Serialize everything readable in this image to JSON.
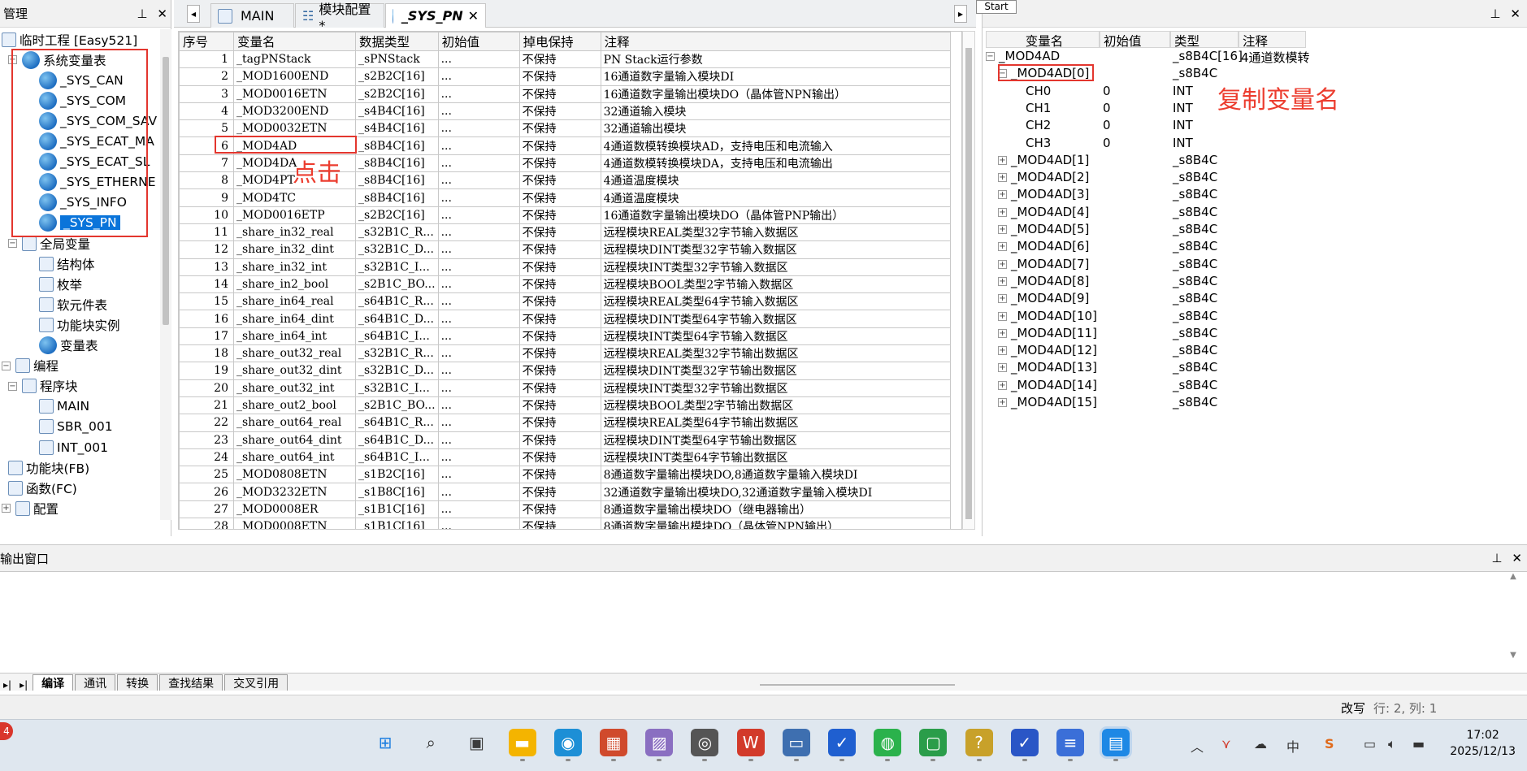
{
  "left_panel": {
    "title": "管理",
    "tree": [
      {
        "label": "临时工程 [Easy521]",
        "icon": "computer-icon",
        "expander": "",
        "name": "tree-project"
      },
      {
        "label": "系统变量表",
        "icon": "globe-icon",
        "expander": "−",
        "name": "tree-system-vars"
      },
      {
        "label": "_SYS_CAN",
        "icon": "globe-icon",
        "expander": "",
        "name": "tree-sys-can"
      },
      {
        "label": "_SYS_COM",
        "icon": "globe-icon",
        "expander": "",
        "name": "tree-sys-com"
      },
      {
        "label": "_SYS_COM_SAV",
        "icon": "globe-icon",
        "expander": "",
        "name": "tree-sys-com-sav"
      },
      {
        "label": "_SYS_ECAT_MA",
        "icon": "globe-icon",
        "expander": "",
        "name": "tree-sys-ecat-ma"
      },
      {
        "label": "_SYS_ECAT_SL",
        "icon": "globe-icon",
        "expander": "",
        "name": "tree-sys-ecat-sl"
      },
      {
        "label": "_SYS_ETHERNE",
        "icon": "globe-icon",
        "expander": "",
        "name": "tree-sys-ethernet"
      },
      {
        "label": "_SYS_INFO",
        "icon": "globe-icon",
        "expander": "",
        "name": "tree-sys-info"
      },
      {
        "label": "_SYS_PN",
        "icon": "globe-icon",
        "expander": "",
        "name": "tree-sys-pn"
      },
      {
        "label": "全局变量",
        "icon": "table-icon",
        "expander": "−",
        "name": "tree-global-vars"
      },
      {
        "label": "结构体",
        "icon": "struct-icon",
        "expander": "",
        "name": "tree-struct"
      },
      {
        "label": "枚举",
        "icon": "enum-icon",
        "expander": "",
        "name": "tree-enum"
      },
      {
        "label": "软元件表",
        "icon": "device-table-icon",
        "expander": "",
        "name": "tree-device-table"
      },
      {
        "label": "功能块实例",
        "icon": "fb-instance-icon",
        "expander": "",
        "name": "tree-fb-instance"
      },
      {
        "label": "变量表",
        "icon": "globe-icon",
        "expander": "",
        "name": "tree-var-table"
      },
      {
        "label": "编程",
        "icon": "program-icon",
        "expander": "−",
        "name": "tree-programming"
      },
      {
        "label": "程序块",
        "icon": "block-icon",
        "expander": "−",
        "name": "tree-program-blocks"
      },
      {
        "label": "MAIN",
        "icon": "ladder-icon",
        "expander": "",
        "name": "tree-main"
      },
      {
        "label": "SBR_001",
        "icon": "ladder-icon",
        "expander": "",
        "name": "tree-sbr-001"
      },
      {
        "label": "INT_001",
        "icon": "ladder-icon",
        "expander": "",
        "name": "tree-int-001"
      },
      {
        "label": "功能块(FB)",
        "icon": "fb-icon",
        "expander": "",
        "name": "tree-fb"
      },
      {
        "label": "函数(FC)",
        "icon": "fc-icon",
        "expander": "",
        "name": "tree-fc"
      },
      {
        "label": "配置",
        "icon": "config-icon",
        "expander": "+",
        "name": "tree-config"
      }
    ]
  },
  "tabs": [
    {
      "label": "MAIN",
      "icon": "ladder-icon"
    },
    {
      "label": "模块配置 *",
      "icon": "module-config-icon"
    },
    {
      "label": "_SYS_PN",
      "icon": "globe-icon",
      "active": true
    }
  ],
  "table": {
    "headers": [
      "序号",
      "变量名",
      "数据类型",
      "初始值",
      "掉电保持",
      "注释"
    ],
    "rows": [
      [
        "1",
        "_tagPNStack",
        "_sPNStack",
        "...",
        "不保持",
        "PN Stack运行参数"
      ],
      [
        "2",
        "_MOD1600END",
        "_s2B2C[16]",
        "...",
        "不保持",
        "16通道数字量输入模块DI"
      ],
      [
        "3",
        "_MOD0016ETN",
        "_s2B2C[16]",
        "...",
        "不保持",
        "16通道数字量输出模块DO（晶体管NPN输出）"
      ],
      [
        "4",
        "_MOD3200END",
        "_s4B4C[16]",
        "...",
        "不保持",
        "32通道输入模块"
      ],
      [
        "5",
        "_MOD0032ETN",
        "_s4B4C[16]",
        "...",
        "不保持",
        "32通道输出模块"
      ],
      [
        "6",
        "_MOD4AD",
        "_s8B4C[16]",
        "...",
        "不保持",
        "4通道数模转换模块AD，支持电压和电流输入"
      ],
      [
        "7",
        "_MOD4DA",
        "_s8B4C[16]",
        "...",
        "不保持",
        "4通道数模转换模块DA，支持电压和电流输出"
      ],
      [
        "8",
        "_MOD4PT",
        "_s8B4C[16]",
        "...",
        "不保持",
        "4通道温度模块"
      ],
      [
        "9",
        "_MOD4TC",
        "_s8B4C[16]",
        "...",
        "不保持",
        "4通道温度模块"
      ],
      [
        "10",
        "_MOD0016ETP",
        "_s2B2C[16]",
        "...",
        "不保持",
        "16通道数字量输出模块DO（晶体管PNP输出）"
      ],
      [
        "11",
        "_share_in32_real",
        "_s32B1C_R...",
        "...",
        "不保持",
        "远程模块REAL类型32字节输入数据区"
      ],
      [
        "12",
        "_share_in32_dint",
        "_s32B1C_D...",
        "...",
        "不保持",
        "远程模块DINT类型32字节输入数据区"
      ],
      [
        "13",
        "_share_in32_int",
        "_s32B1C_I...",
        "...",
        "不保持",
        "远程模块INT类型32字节输入数据区"
      ],
      [
        "14",
        "_share_in2_bool",
        "_s2B1C_BO...",
        "...",
        "不保持",
        "远程模块BOOL类型2字节输入数据区"
      ],
      [
        "15",
        "_share_in64_real",
        "_s64B1C_R...",
        "...",
        "不保持",
        "远程模块REAL类型64字节输入数据区"
      ],
      [
        "16",
        "_share_in64_dint",
        "_s64B1C_D...",
        "...",
        "不保持",
        "远程模块DINT类型64字节输入数据区"
      ],
      [
        "17",
        "_share_in64_int",
        "_s64B1C_I...",
        "...",
        "不保持",
        "远程模块INT类型64字节输入数据区"
      ],
      [
        "18",
        "_share_out32_real",
        "_s32B1C_R...",
        "...",
        "不保持",
        "远程模块REAL类型32字节输出数据区"
      ],
      [
        "19",
        "_share_out32_dint",
        "_s32B1C_D...",
        "...",
        "不保持",
        "远程模块DINT类型32字节输出数据区"
      ],
      [
        "20",
        "_share_out32_int",
        "_s32B1C_I...",
        "...",
        "不保持",
        "远程模块INT类型32字节输出数据区"
      ],
      [
        "21",
        "_share_out2_bool",
        "_s2B1C_BO...",
        "...",
        "不保持",
        "远程模块BOOL类型2字节输出数据区"
      ],
      [
        "22",
        "_share_out64_real",
        "_s64B1C_R...",
        "...",
        "不保持",
        "远程模块REAL类型64字节输出数据区"
      ],
      [
        "23",
        "_share_out64_dint",
        "_s64B1C_D...",
        "...",
        "不保持",
        "远程模块DINT类型64字节输出数据区"
      ],
      [
        "24",
        "_share_out64_int",
        "_s64B1C_I...",
        "...",
        "不保持",
        "远程模块INT类型64字节输出数据区"
      ],
      [
        "25",
        "_MOD0808ETN",
        "_s1B2C[16]",
        "...",
        "不保持",
        "8通道数字量输出模块DO,8通道数字量输入模块DI"
      ],
      [
        "26",
        "_MOD3232ETN",
        "_s1B8C[16]",
        "...",
        "不保持",
        "32通道数字量输出模块DO,32通道数字量输入模块DI"
      ],
      [
        "27",
        "_MOD0008ER",
        "_s1B1C[16]",
        "...",
        "不保持",
        "8通道数字量输出模块DO（继电器输出）"
      ],
      [
        "28",
        "_MOD0008ETN",
        "_s1B1C[16]",
        "...",
        "不保持",
        "8通道数字量输出模块DO（晶体管NPN输出）"
      ]
    ]
  },
  "annotations": {
    "click_label": "点击",
    "copy_label": "复制变量名"
  },
  "right_panel": {
    "tooltip": "Start",
    "headers": [
      "变量名",
      "初始值",
      "类型",
      "注释"
    ],
    "rows": [
      {
        "expander": "−",
        "name": "_MOD4AD",
        "init": "",
        "type": "_s8B4C[16]",
        "comment": "4通道数模转",
        "indent": 0
      },
      {
        "expander": "−",
        "name": "_MOD4AD[0]",
        "init": "",
        "type": "_s8B4C",
        "comment": "",
        "indent": 1
      },
      {
        "expander": "",
        "name": "CH0",
        "init": "0",
        "type": "INT",
        "comment": "",
        "indent": 2
      },
      {
        "expander": "",
        "name": "CH1",
        "init": "0",
        "type": "INT",
        "comment": "",
        "indent": 2
      },
      {
        "expander": "",
        "name": "CH2",
        "init": "0",
        "type": "INT",
        "comment": "",
        "indent": 2
      },
      {
        "expander": "",
        "name": "CH3",
        "init": "0",
        "type": "INT",
        "comment": "",
        "indent": 2
      },
      {
        "expander": "+",
        "name": "_MOD4AD[1]",
        "init": "",
        "type": "_s8B4C",
        "comment": "",
        "indent": 1
      },
      {
        "expander": "+",
        "name": "_MOD4AD[2]",
        "init": "",
        "type": "_s8B4C",
        "comment": "",
        "indent": 1
      },
      {
        "expander": "+",
        "name": "_MOD4AD[3]",
        "init": "",
        "type": "_s8B4C",
        "comment": "",
        "indent": 1
      },
      {
        "expander": "+",
        "name": "_MOD4AD[4]",
        "init": "",
        "type": "_s8B4C",
        "comment": "",
        "indent": 1
      },
      {
        "expander": "+",
        "name": "_MOD4AD[5]",
        "init": "",
        "type": "_s8B4C",
        "comment": "",
        "indent": 1
      },
      {
        "expander": "+",
        "name": "_MOD4AD[6]",
        "init": "",
        "type": "_s8B4C",
        "comment": "",
        "indent": 1
      },
      {
        "expander": "+",
        "name": "_MOD4AD[7]",
        "init": "",
        "type": "_s8B4C",
        "comment": "",
        "indent": 1
      },
      {
        "expander": "+",
        "name": "_MOD4AD[8]",
        "init": "",
        "type": "_s8B4C",
        "comment": "",
        "indent": 1
      },
      {
        "expander": "+",
        "name": "_MOD4AD[9]",
        "init": "",
        "type": "_s8B4C",
        "comment": "",
        "indent": 1
      },
      {
        "expander": "+",
        "name": "_MOD4AD[10]",
        "init": "",
        "type": "_s8B4C",
        "comment": "",
        "indent": 1
      },
      {
        "expander": "+",
        "name": "_MOD4AD[11]",
        "init": "",
        "type": "_s8B4C",
        "comment": "",
        "indent": 1
      },
      {
        "expander": "+",
        "name": "_MOD4AD[12]",
        "init": "",
        "type": "_s8B4C",
        "comment": "",
        "indent": 1
      },
      {
        "expander": "+",
        "name": "_MOD4AD[13]",
        "init": "",
        "type": "_s8B4C",
        "comment": "",
        "indent": 1
      },
      {
        "expander": "+",
        "name": "_MOD4AD[14]",
        "init": "",
        "type": "_s8B4C",
        "comment": "",
        "indent": 1
      },
      {
        "expander": "+",
        "name": "_MOD4AD[15]",
        "init": "",
        "type": "_s8B4C",
        "comment": "",
        "indent": 1
      }
    ]
  },
  "output": {
    "title": "输出窗口",
    "tabs": [
      "编译",
      "通讯",
      "转换",
      "查找结果",
      "交叉引用"
    ]
  },
  "status": {
    "mode": "改写",
    "position": "行:   2, 列:   1"
  },
  "taskbar": {
    "badge": "4",
    "time": "17:02",
    "date": "2025/12/13",
    "ime": "中",
    "icons": [
      "windows-start-icon",
      "search-icon",
      "task-view-icon",
      "file-explorer-icon",
      "edge-icon",
      "store-icon",
      "paint-icon",
      "camera-icon",
      "wps-icon",
      "remote-desktop-icon",
      "plc-app-icon",
      "wechat-icon",
      "chat-icon",
      "help-tool-icon",
      "plc-app-icon-2",
      "notepad-icon",
      "auto-app-icon"
    ]
  },
  "colors": {
    "accent": "#0a74da",
    "annotation_red": "#e3362e",
    "taskbar_bg": "#dfe7ef"
  }
}
